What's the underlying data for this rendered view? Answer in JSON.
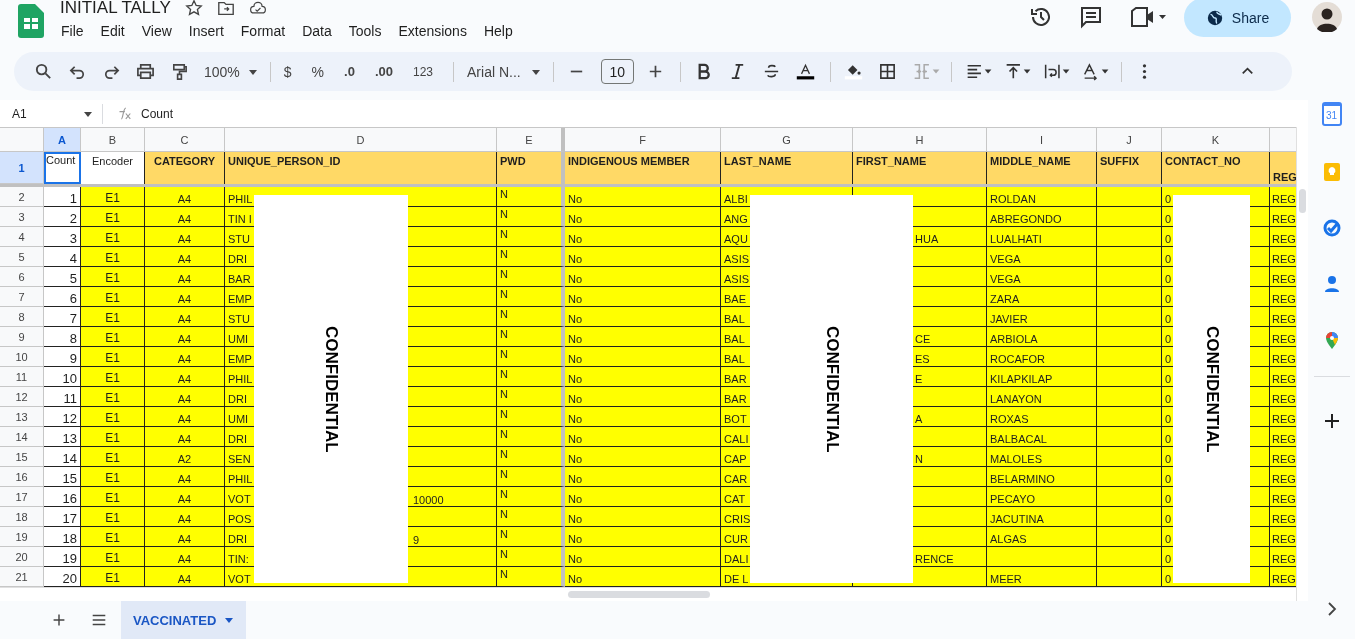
{
  "doc": {
    "title": "INITIAL TALLY"
  },
  "menu": [
    "File",
    "Edit",
    "View",
    "Insert",
    "Format",
    "Data",
    "Tools",
    "Extensions",
    "Help"
  ],
  "share": {
    "label": "Share"
  },
  "toolbar": {
    "zoom": "100%",
    "currency": "$",
    "percent": "%",
    "decrease_decimal": ".0",
    "increase_decimal": ".00",
    "number_format": "123",
    "font": "Arial N...",
    "font_size": "10"
  },
  "formula_bar": {
    "cell": "A1",
    "formula": "Count"
  },
  "columns": [
    {
      "letter": "A",
      "selected": true
    },
    {
      "letter": "B",
      "selected": false
    },
    {
      "letter": "C",
      "selected": false
    },
    {
      "letter": "D",
      "selected": false
    },
    {
      "letter": "E",
      "selected": false
    },
    {
      "letter": "F",
      "selected": false
    },
    {
      "letter": "G",
      "selected": false
    },
    {
      "letter": "H",
      "selected": false
    },
    {
      "letter": "I",
      "selected": false
    },
    {
      "letter": "J",
      "selected": false
    },
    {
      "letter": "K",
      "selected": false
    }
  ],
  "header_row": {
    "num": "1",
    "selected": true,
    "cells": [
      "Count",
      "Encoder",
      "CATEGORY",
      "UNIQUE_PERSON_ID",
      "PWD",
      "INDIGENOUS MEMBER",
      "LAST_NAME",
      "FIRST_NAME",
      "MIDDLE_NAME",
      "SUFFIX",
      "CONTACT_NO",
      "REG"
    ]
  },
  "rows": [
    {
      "num": "2",
      "selected": false,
      "count": "1",
      "encoder": "E1",
      "category": "A4",
      "id": "PHIL",
      "pwd": "N",
      "indigenous": "No",
      "last_name": "ALBI",
      "middle_name": "ROLDAN",
      "contact": "0",
      "column_12": "REG"
    },
    {
      "num": "3",
      "selected": false,
      "count": "2",
      "encoder": "E1",
      "category": "A4",
      "id": "TIN I",
      "pwd": "N",
      "indigenous": "No",
      "last_name": "ANG",
      "middle_name": "ABREGONDO",
      "contact": "0",
      "column_12": "REG"
    },
    {
      "num": "4",
      "selected": false,
      "count": "3",
      "encoder": "E1",
      "category": "A4",
      "id": "STU",
      "pwd": "N",
      "indigenous": "No",
      "last_name": "AQU",
      "first_name": "HUA",
      "middle_name": "LUALHATI",
      "contact": "0",
      "column_12": "REG"
    },
    {
      "num": "5",
      "selected": false,
      "count": "4",
      "encoder": "E1",
      "category": "A4",
      "id": "DRI",
      "pwd": "N",
      "indigenous": "No",
      "last_name": "ASIS",
      "middle_name": "VEGA",
      "contact": "0",
      "column_12": "REG"
    },
    {
      "num": "6",
      "selected": false,
      "count": "5",
      "encoder": "E1",
      "category": "A4",
      "id": "BAR",
      "pwd": "N",
      "indigenous": "No",
      "last_name": "ASIS",
      "middle_name": "VEGA",
      "contact": "0",
      "column_12": "REG"
    },
    {
      "num": "7",
      "selected": false,
      "count": "6",
      "encoder": "E1",
      "category": "A4",
      "id": "EMP",
      "pwd": "N",
      "indigenous": "No",
      "last_name": "BAE",
      "middle_name": "ZARA",
      "contact": "0",
      "column_12": "REG"
    },
    {
      "num": "8",
      "selected": false,
      "count": "7",
      "encoder": "E1",
      "category": "A4",
      "id": "STU",
      "pwd": "N",
      "indigenous": "No",
      "last_name": "BAL",
      "middle_name": "JAVIER",
      "contact": "0",
      "column_12": "REG"
    },
    {
      "num": "9",
      "selected": false,
      "count": "8",
      "encoder": "E1",
      "category": "A4",
      "id": "UMI",
      "pwd": "N",
      "indigenous": "No",
      "last_name": "BAL",
      "first_name": "CE",
      "middle_name": "ARBIOLA",
      "contact": "0",
      "column_12": "REG"
    },
    {
      "num": "10",
      "selected": false,
      "count": "9",
      "encoder": "E1",
      "category": "A4",
      "id": "EMP",
      "pwd": "N",
      "indigenous": "No",
      "last_name": "BAL",
      "first_name": "ES",
      "middle_name": "ROCAFOR",
      "contact": "0",
      "column_12": "REG"
    },
    {
      "num": "11",
      "selected": false,
      "count": "10",
      "encoder": "E1",
      "category": "A4",
      "id": "PHIL",
      "pwd": "N",
      "indigenous": "No",
      "last_name": "BAR",
      "first_name": "E",
      "middle_name": "KILAPKILAP",
      "contact": "0",
      "column_12": "REG"
    },
    {
      "num": "12",
      "selected": false,
      "count": "11",
      "encoder": "E1",
      "category": "A4",
      "id": "DRI",
      "pwd": "N",
      "indigenous": "No",
      "last_name": "BAR",
      "middle_name": "LANAYON",
      "contact": "0",
      "column_12": "REG"
    },
    {
      "num": "13",
      "selected": false,
      "count": "12",
      "encoder": "E1",
      "category": "A4",
      "id": "UMI",
      "pwd": "N",
      "indigenous": "No",
      "last_name": "BOT",
      "first_name": "A",
      "middle_name": "ROXAS",
      "contact": "0",
      "column_12": "REG"
    },
    {
      "num": "14",
      "selected": false,
      "count": "13",
      "encoder": "E1",
      "category": "A4",
      "id": "DRI",
      "pwd": "N",
      "indigenous": "No",
      "last_name": "CALI",
      "middle_name": "BALBACAL",
      "contact": "0",
      "column_12": "REG"
    },
    {
      "num": "15",
      "selected": false,
      "count": "14",
      "encoder": "E1",
      "category": "A2",
      "id": "SEN",
      "pwd": "N",
      "indigenous": "No",
      "last_name": "CAP",
      "first_name": "N",
      "middle_name": "MALOLES",
      "contact": "0",
      "column_12": "REG"
    },
    {
      "num": "16",
      "selected": false,
      "count": "15",
      "encoder": "E1",
      "category": "A4",
      "id": "PHIL",
      "pwd": "N",
      "indigenous": "No",
      "last_name": "CAR",
      "middle_name": "BELARMINO",
      "contact": "0",
      "column_12": "REG"
    },
    {
      "num": "17",
      "selected": false,
      "count": "16",
      "encoder": "E1",
      "category": "A4",
      "id": "VOT",
      "id_tail": "10000",
      "pwd": "N",
      "indigenous": "No",
      "last_name": "CAT",
      "middle_name": "PECAYO",
      "contact": "0",
      "column_12": "REG"
    },
    {
      "num": "18",
      "selected": false,
      "count": "17",
      "encoder": "E1",
      "category": "A4",
      "id": "POS",
      "pwd": "N",
      "indigenous": "No",
      "last_name": "CRIS",
      "middle_name": "JACUTINA",
      "contact": "0",
      "column_12": "REG"
    },
    {
      "num": "19",
      "selected": false,
      "count": "18",
      "encoder": "E1",
      "category": "A4",
      "id": "DRI",
      "id_tail": "9",
      "pwd": "N",
      "indigenous": "No",
      "last_name": "CUR",
      "middle_name": "ALGAS",
      "contact": "0",
      "column_12": "REG"
    },
    {
      "num": "20",
      "selected": false,
      "count": "19",
      "encoder": "E1",
      "category": "A4",
      "id": "TIN:",
      "pwd": "N",
      "indigenous": "No",
      "last_name": "DALI",
      "first_name": "RENCE",
      "contact": "0",
      "column_12": "REG"
    },
    {
      "num": "21",
      "selected": false,
      "count": "20",
      "encoder": "E1",
      "category": "A4",
      "id": "VOT",
      "pwd": "N",
      "indigenous": "No",
      "last_name": "DE L",
      "middle_name": "MEER",
      "contact": "0",
      "column_12": "REG"
    }
  ],
  "redactions": [
    {
      "label": "CONFIDENTIAL"
    },
    {
      "label": "CONFIDENTIAL"
    },
    {
      "label": "CONFIDENTIAL"
    }
  ],
  "side_panel": {
    "calendar_day": "31"
  },
  "sheets": [
    {
      "name": "VACCINATED",
      "selected": true
    }
  ]
}
